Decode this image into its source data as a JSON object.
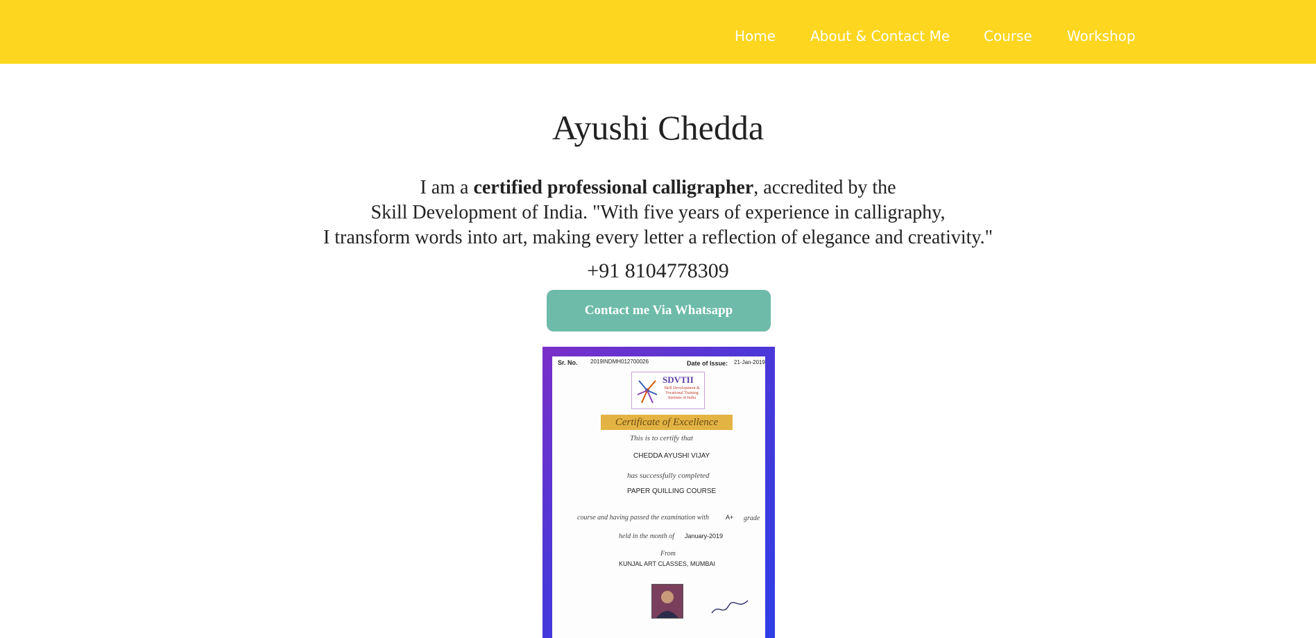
{
  "nav": {
    "items": [
      "Home",
      "About & Contact Me",
      "Course",
      "Workshop"
    ]
  },
  "profile": {
    "name": "Ayushi Chedda",
    "bio_line1_pre": "I am a ",
    "bio_line1_bold": "certified professional calligrapher",
    "bio_line1_post": ", accredited by the",
    "bio_line2": "Skill Development of India. \"With five years of experience in calligraphy,",
    "bio_line3": "I transform words into art, making every letter a reflection of elegance and creativity.\"",
    "phone": "+91 8104778309",
    "whatsapp_button": "Contact me Via Whatsapp"
  },
  "certificate": {
    "sr_label": "Sr. No.",
    "sr_value": "2019INDMH012700026",
    "date_label": "Date of Issue:",
    "date_value": "21-Jan-2019",
    "logo_title": "SDVTII",
    "logo_subtitle": "Skill Development & Vocational Training Institute of India",
    "title": "Certificate of Excellence",
    "certify_text": "This is to certify that",
    "recipient": "CHEDDA AYUSHI VIJAY",
    "completed_text": "has successfully completed",
    "course": "PAPER QUILLING COURSE",
    "exam_text": "course and having passed the examination with",
    "grade": "A+",
    "grade_label": "grade",
    "month_text": "held in the month of",
    "month_value": "January-2019",
    "from_text": "From",
    "institute": "KUNJAL ART CLASSES, MUMBAI",
    "colors": {
      "border_start": "#7a2fc8",
      "border_end": "#2f3ee6",
      "banner": "#e3b443"
    }
  },
  "colors": {
    "navbar": "#fdd61f",
    "button": "#6dbba8"
  }
}
